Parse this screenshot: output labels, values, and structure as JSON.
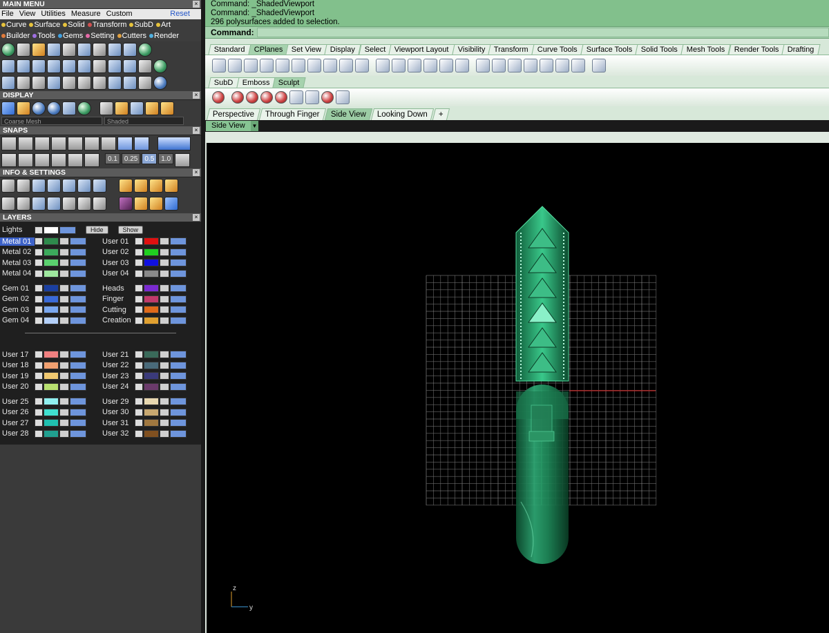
{
  "main_menu": {
    "title": "MAIN MENU",
    "menus": [
      "File",
      "View",
      "Utilities",
      "Measure",
      "Custom"
    ],
    "reset_label": "Reset",
    "categories_row1": [
      {
        "label": "Curve",
        "color": "#e6c23c"
      },
      {
        "label": "Surface",
        "color": "#e6c23c"
      },
      {
        "label": "Solid",
        "color": "#e6c23c"
      },
      {
        "label": "Transform",
        "color": "#d05050"
      },
      {
        "label": "SubD",
        "color": "#e6c23c"
      },
      {
        "label": "Art",
        "color": "#e6c23c"
      }
    ],
    "categories_row2": [
      {
        "label": "Builder",
        "color": "#e07a3a"
      },
      {
        "label": "Tools",
        "color": "#9f6fe0"
      },
      {
        "label": "Gems",
        "color": "#3fa0e0"
      },
      {
        "label": "Setting",
        "color": "#e66aa8"
      },
      {
        "label": "Cutters",
        "color": "#e0a040"
      },
      {
        "label": "Render",
        "color": "#50b0e0"
      }
    ]
  },
  "display": {
    "title": "DISPLAY",
    "mesh_mode": "Coarse Mesh",
    "shade_mode": "Shaded"
  },
  "snaps": {
    "title": "SNAPS",
    "values": [
      "0.1",
      "0.25",
      "0.5",
      "1.0"
    ],
    "active_value": "0.5"
  },
  "info": {
    "title": "INFO & SETTINGS"
  },
  "layers": {
    "title": "LAYERS",
    "lights_label": "Lights",
    "hide_label": "Hide",
    "show_label": "Show",
    "groups": [
      {
        "left": [
          {
            "name": "Metal 01",
            "color": "#2e8a4c",
            "selected": true
          },
          {
            "name": "Metal 02",
            "color": "#3caa5c"
          },
          {
            "name": "Metal 03",
            "color": "#5ad06e"
          },
          {
            "name": "Metal 04",
            "color": "#9fe89f"
          }
        ],
        "right": [
          {
            "name": "User 01",
            "color": "#e01010"
          },
          {
            "name": "User 02",
            "color": "#20d020"
          },
          {
            "name": "User 03",
            "color": "#1010e0"
          },
          {
            "name": "User 04",
            "color": "#8a8a8a"
          }
        ]
      },
      {
        "left": [
          {
            "name": "Gem 01",
            "color": "#1a3fa0"
          },
          {
            "name": "Gem 02",
            "color": "#3a6ad8"
          },
          {
            "name": "Gem 03",
            "color": "#7aa8f0"
          },
          {
            "name": "Gem 04",
            "color": "#b4d0f8"
          }
        ],
        "right": [
          {
            "name": "Heads",
            "color": "#7a2ad0"
          },
          {
            "name": "Finger",
            "color": "#c03a6a"
          },
          {
            "name": "Cutting",
            "color": "#e06a1a"
          },
          {
            "name": "Creation",
            "color": "#e0a030"
          }
        ]
      },
      {
        "left": [
          {
            "name": "User 17",
            "color": "#f08080"
          },
          {
            "name": "User 18",
            "color": "#f0a070"
          },
          {
            "name": "User 19",
            "color": "#f0c870"
          },
          {
            "name": "User 20",
            "color": "#b8e070"
          }
        ],
        "right": [
          {
            "name": "User 21",
            "color": "#3a6a5a"
          },
          {
            "name": "User 22",
            "color": "#4a6a7a"
          },
          {
            "name": "User 23",
            "color": "#3a3a7a"
          },
          {
            "name": "User 24",
            "color": "#6a3a6a"
          }
        ]
      },
      {
        "left": [
          {
            "name": "User 25",
            "color": "#90f0f0"
          },
          {
            "name": "User 26",
            "color": "#40e0d0"
          },
          {
            "name": "User 27",
            "color": "#20c0b0"
          },
          {
            "name": "User 28",
            "color": "#20a090"
          }
        ],
        "right": [
          {
            "name": "User 29",
            "color": "#e8d8b0"
          },
          {
            "name": "User 30",
            "color": "#c8a870"
          },
          {
            "name": "User 31",
            "color": "#a07840"
          },
          {
            "name": "User 32",
            "color": "#805020"
          }
        ]
      }
    ]
  },
  "command": {
    "history": [
      "Command: _ShadedViewport",
      "Command: _ShadedViewport",
      "296 polysurfaces added to selection."
    ],
    "prompt": "Command:"
  },
  "toolbar_tabs": [
    "Standard",
    "CPlanes",
    "Set View",
    "Display",
    "Select",
    "Viewport Layout",
    "Visibility",
    "Transform",
    "Curve Tools",
    "Surface Tools",
    "Solid Tools",
    "Mesh Tools",
    "Render Tools",
    "Drafting"
  ],
  "toolbar_tabs_active": "CPlanes",
  "sculpt_tabs": [
    "SubD",
    "Emboss",
    "Sculpt"
  ],
  "sculpt_tabs_active": "Sculpt",
  "viewport_tabs": [
    "Perspective",
    "Through Finger",
    "Side View",
    "Looking Down"
  ],
  "viewport_tabs_active": "Side View",
  "viewport_add_icon": "plus-icon",
  "viewport": {
    "title": "Side View",
    "axis_z": "z",
    "axis_y": "y",
    "background": "#000000",
    "model_color": "#1f8a5a"
  }
}
